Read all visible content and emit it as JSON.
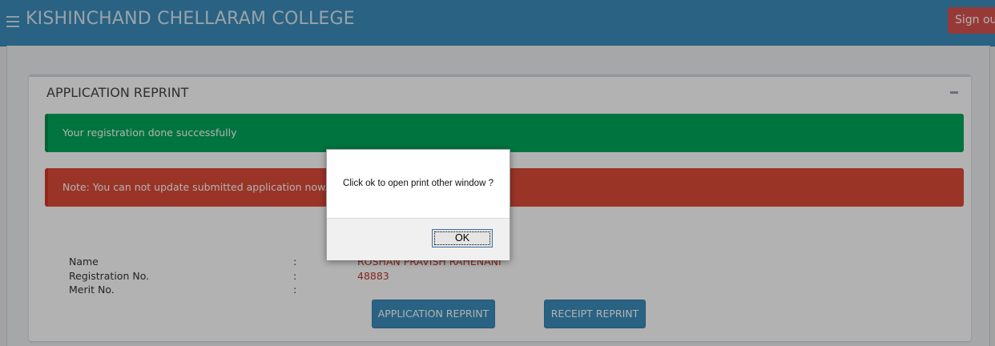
{
  "header": {
    "title": "KISHINCHAND CHELLARAM COLLEGE",
    "menu_icon": "hamburger-menu-icon",
    "signout_label": "Sign out"
  },
  "panel": {
    "title": "APPLICATION REPRINT",
    "collapse_icon": "minus-icon",
    "success_message": "Your registration done successfully",
    "note_message": "Note: You can not update submitted application now.",
    "rows": [
      {
        "label": "Name",
        "sep": ":",
        "value": "ROSHAN PRAVISH RAHENANI"
      },
      {
        "label": "Registration No.",
        "sep": ":",
        "value": "48883"
      },
      {
        "label": "Merit No.",
        "sep": ":",
        "value": ""
      }
    ],
    "application_reprint_label": "APPLICATION REPRINT",
    "receipt_reprint_label": "RECEIPT REPRINT"
  },
  "dialog": {
    "message": "Click ok to open print other window ?",
    "ok_label": "OK"
  },
  "colors": {
    "header": "#3c8dbc",
    "success": "#00a65a",
    "danger": "#dd4b39",
    "button": "#3c8dbc",
    "signout": "#d9534f"
  }
}
